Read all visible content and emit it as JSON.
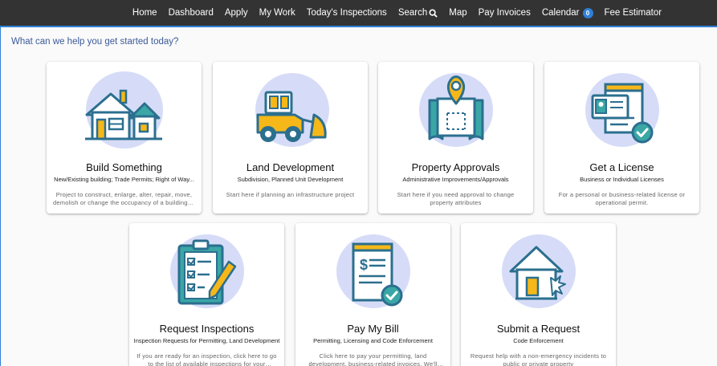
{
  "nav": {
    "items": [
      {
        "label": "Home"
      },
      {
        "label": "Dashboard"
      },
      {
        "label": "Apply"
      },
      {
        "label": "My Work"
      },
      {
        "label": "Today's Inspections"
      },
      {
        "label": "Search"
      },
      {
        "label": "Map"
      },
      {
        "label": "Pay Invoices"
      },
      {
        "label": "Calendar",
        "badge": "0"
      },
      {
        "label": "Fee Estimator"
      }
    ]
  },
  "intro": "What can we help you get started today?",
  "cards": [
    {
      "title": "Build Something",
      "subtitle": "New/Existing building; Trade Permits; Right of Way...",
      "desc": "Project to construct, enlarge, alter, repair, move, demolish or change the occupancy of a building or structure.",
      "icon": "house-icon"
    },
    {
      "title": "Land Development",
      "subtitle": "Subdivision, Planned Unit Development",
      "desc": "Start here if planning an infrastructure project",
      "icon": "bulldozer-icon"
    },
    {
      "title": "Property Approvals",
      "subtitle": "Administrative Improvements/Approvals",
      "desc": "Start here if you need approval to change property attributes",
      "icon": "map-pin-icon"
    },
    {
      "title": "Get a License",
      "subtitle": "Business or Individual Licenses",
      "desc": "For a personal or business-related license or operational permit.",
      "icon": "license-icon"
    },
    {
      "title": "Request Inspections",
      "subtitle": "Inspection Requests for Permitting, Land Development",
      "desc": "If you are ready for an inspection, click here to go to the list of available inspections for your records.",
      "icon": "clipboard-icon"
    },
    {
      "title": "Pay My Bill",
      "subtitle": "Permitting, Licensing and Code Enforcement",
      "desc": "Click here to pay your permitting, land development, business-related invoices. We'll guide you through.",
      "icon": "bill-icon"
    },
    {
      "title": "Submit a Request",
      "subtitle": "Code Enforcement",
      "desc": "Request help with a non-emergency incidents to public or private property",
      "icon": "broken-house-icon"
    }
  ],
  "colors": {
    "accent": "#2f7fd6",
    "circle": "#d6dcf7",
    "outline": "#2b6f8f",
    "teal": "#3aa6a6",
    "yellow": "#f6b719",
    "nav_bg": "#333333"
  }
}
